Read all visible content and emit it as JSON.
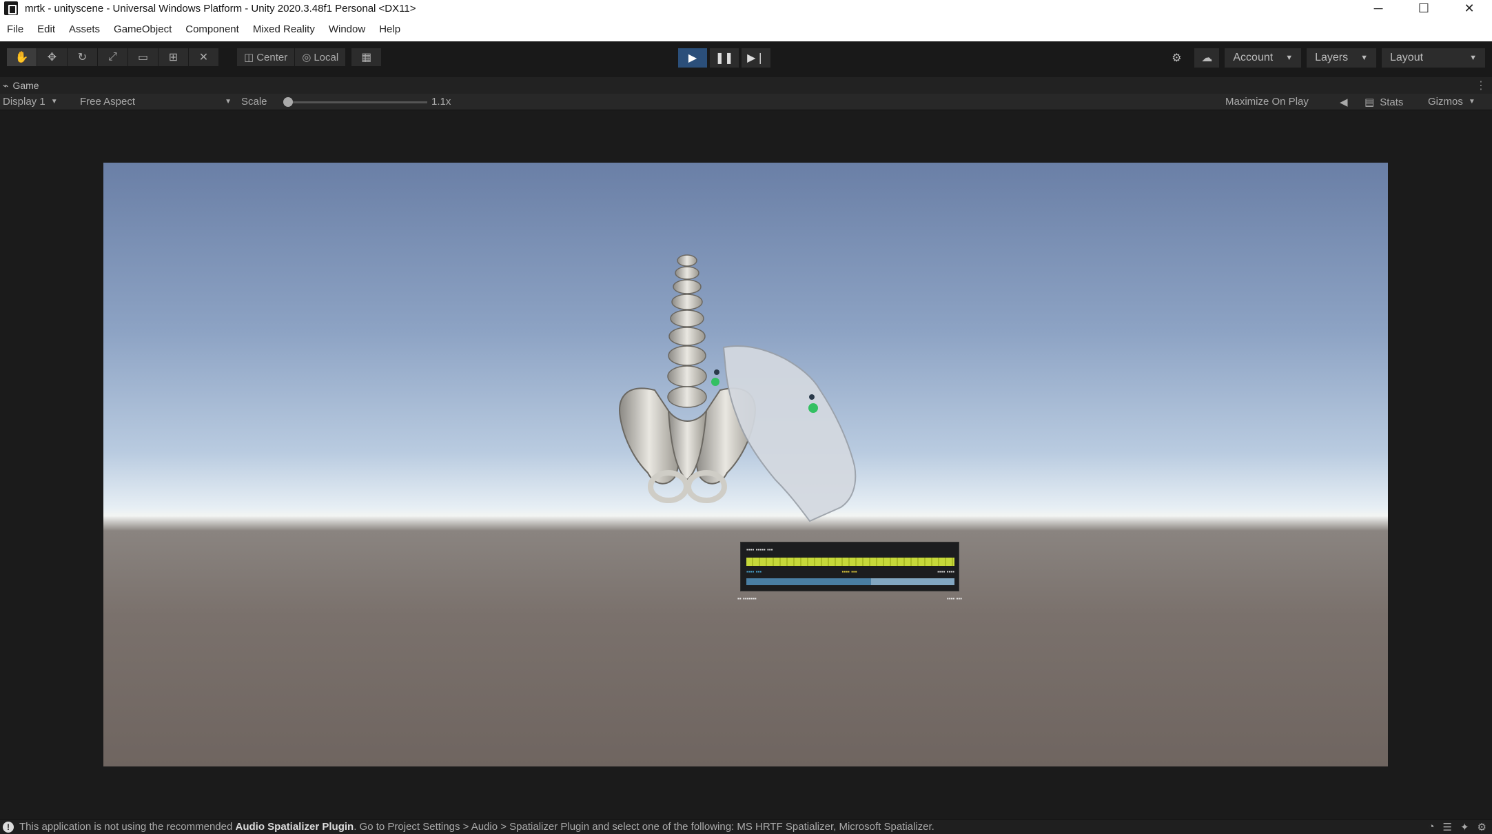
{
  "window": {
    "title": "mrtk - unityscene - Universal Windows Platform - Unity 2020.3.48f1 Personal <DX11>",
    "controls": [
      "─",
      "☐",
      "✕"
    ]
  },
  "menu": [
    "File",
    "Edit",
    "Assets",
    "GameObject",
    "Component",
    "Mixed Reality",
    "Window",
    "Help"
  ],
  "toolbar": {
    "tool_icons": [
      "hand-tool-icon",
      "move-tool-icon",
      "rotate-tool-icon",
      "scale-tool-icon",
      "rect-tool-icon",
      "transform-tool-icon",
      "custom-tool-icon"
    ],
    "pivot_label": "Center",
    "space_label": "Local",
    "account_label": "Account",
    "layers_label": "Layers",
    "layout_label": "Layout"
  },
  "game_tab": {
    "label": "Game"
  },
  "game_bar": {
    "display": "Display 1",
    "aspect": "Free Aspect",
    "scale_label": "Scale",
    "scale_value": "1.1x",
    "maximize": "Maximize On Play",
    "stats": "Stats",
    "gizmos": "Gizmos"
  },
  "status": {
    "text_prefix": "This application is not using the recommended ",
    "text_bold": "Audio Spatializer Plugin",
    "text_suffix": ". Go to Project Settings > Audio > Spatializer Plugin and select one of the following: MS HRTF Spatializer, Microsoft Spatializer."
  },
  "colors": {
    "editor_bg": "#191919",
    "play_active": "#2b4f7a",
    "sky_top": "#6a7fa6",
    "horizon": "#f3f5f3",
    "ground": "#7a716c"
  }
}
